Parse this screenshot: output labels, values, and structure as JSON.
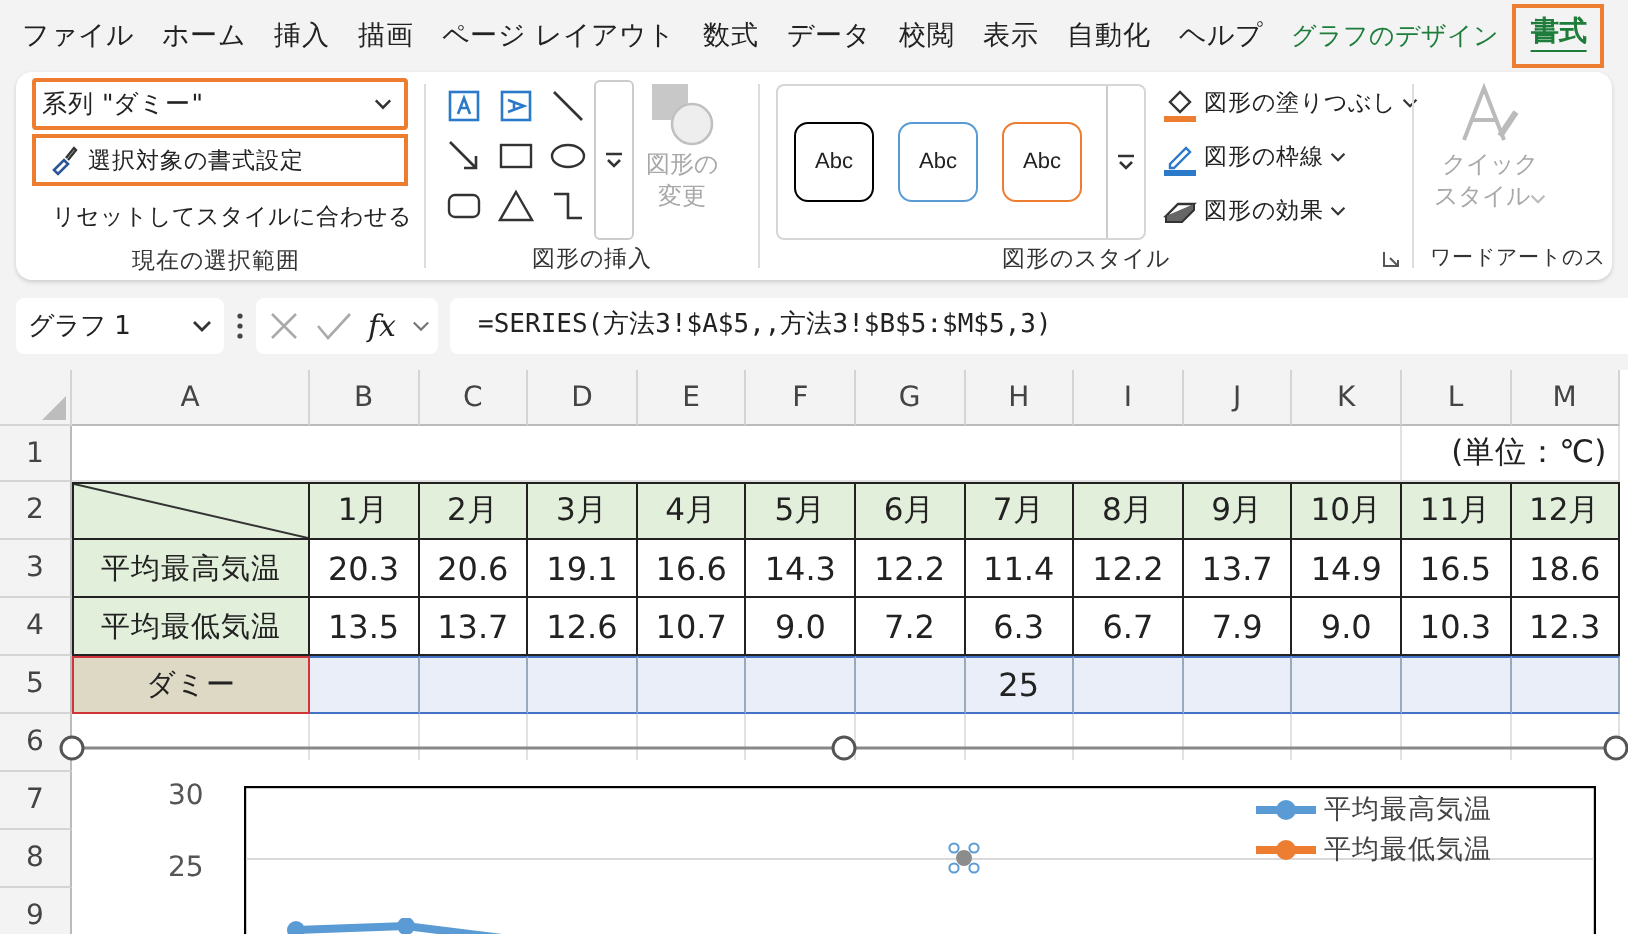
{
  "ribbon_tabs": [
    {
      "label": "ファイル",
      "selected": false,
      "kind": "normal"
    },
    {
      "label": "ホーム",
      "selected": false,
      "kind": "normal"
    },
    {
      "label": "挿入",
      "selected": false,
      "kind": "normal"
    },
    {
      "label": "描画",
      "selected": false,
      "kind": "normal"
    },
    {
      "label": "ページ レイアウト",
      "selected": false,
      "kind": "normal"
    },
    {
      "label": "数式",
      "selected": false,
      "kind": "normal"
    },
    {
      "label": "データ",
      "selected": false,
      "kind": "normal"
    },
    {
      "label": "校閲",
      "selected": false,
      "kind": "normal"
    },
    {
      "label": "表示",
      "selected": false,
      "kind": "normal"
    },
    {
      "label": "自動化",
      "selected": false,
      "kind": "normal"
    },
    {
      "label": "ヘルプ",
      "selected": false,
      "kind": "normal"
    },
    {
      "label": "グラフのデザイン",
      "selected": false,
      "kind": "context"
    },
    {
      "label": "書式",
      "selected": true,
      "kind": "context"
    }
  ],
  "selection_group": {
    "series_dropdown": "系列 \"ダミー\"",
    "format_button": "選択対象の書式設定",
    "reset_button": "リセットしてスタイルに合わせる",
    "label": "現在の選択範囲"
  },
  "insert_shapes_group": {
    "change_shape_button": {
      "lines": [
        "図形の",
        "変更"
      ],
      "disabled": true
    },
    "label": "図形の挿入"
  },
  "shape_styles_group": {
    "presets": [
      {
        "label": "Abc",
        "color": "#000000"
      },
      {
        "label": "Abc",
        "color": "#5b9bd5"
      },
      {
        "label": "Abc",
        "color": "#ed7d31"
      }
    ],
    "commands": [
      {
        "label": "図形の塗りつぶし",
        "kind": "fill"
      },
      {
        "label": "図形の枠線",
        "kind": "outline"
      },
      {
        "label": "図形の効果",
        "kind": "effects"
      }
    ],
    "label": "図形のスタイル"
  },
  "wordart_group": {
    "quick_style_button": {
      "lines": [
        "クイック",
        "スタイル"
      ],
      "disabled": true
    },
    "label": "ワードアートのス"
  },
  "formula_bar": {
    "name_box": "グラフ 1",
    "fx": "fx",
    "formula": "=SERIES(方法3!$A$5,,方法3!$B$5:$M$5,3)"
  },
  "sheet": {
    "columns": [
      "A",
      "B",
      "C",
      "D",
      "E",
      "F",
      "G",
      "H",
      "I",
      "J",
      "K",
      "L",
      "M"
    ],
    "rows": [
      {
        "number": "1",
        "kind": "note",
        "note": "(単位：℃)"
      },
      {
        "number": "2",
        "kind": "header",
        "cells": [
          "1月",
          "2月",
          "3月",
          "4月",
          "5月",
          "6月",
          "7月",
          "8月",
          "9月",
          "10月",
          "11月",
          "12月"
        ]
      },
      {
        "number": "3",
        "kind": "data",
        "label": "平均最高気温",
        "cells": [
          "20.3",
          "20.6",
          "19.1",
          "16.6",
          "14.3",
          "12.2",
          "11.4",
          "12.2",
          "13.7",
          "14.9",
          "16.5",
          "18.6"
        ]
      },
      {
        "number": "4",
        "kind": "data",
        "label": "平均最低気温",
        "cells": [
          "13.5",
          "13.7",
          "12.6",
          "10.7",
          "9.0",
          "7.2",
          "6.3",
          "6.7",
          "7.9",
          "9.0",
          "10.3",
          "12.3"
        ]
      },
      {
        "number": "5",
        "kind": "series",
        "label": "ダミー",
        "selected": true,
        "cells": [
          null,
          null,
          null,
          null,
          null,
          null,
          "25",
          null,
          null,
          null,
          null,
          null
        ]
      },
      {
        "number": "6",
        "kind": "blank"
      },
      {
        "number": "7",
        "kind": "blank"
      },
      {
        "number": "8",
        "kind": "blank"
      },
      {
        "number": "9",
        "kind": "blank"
      }
    ]
  },
  "chart": {
    "yticks": [
      "30",
      "25"
    ],
    "legend": [
      {
        "name": "平均最高気温",
        "color": "#5b9bd5"
      },
      {
        "name": "平均最低気温",
        "color": "#ed7d31"
      }
    ]
  }
}
